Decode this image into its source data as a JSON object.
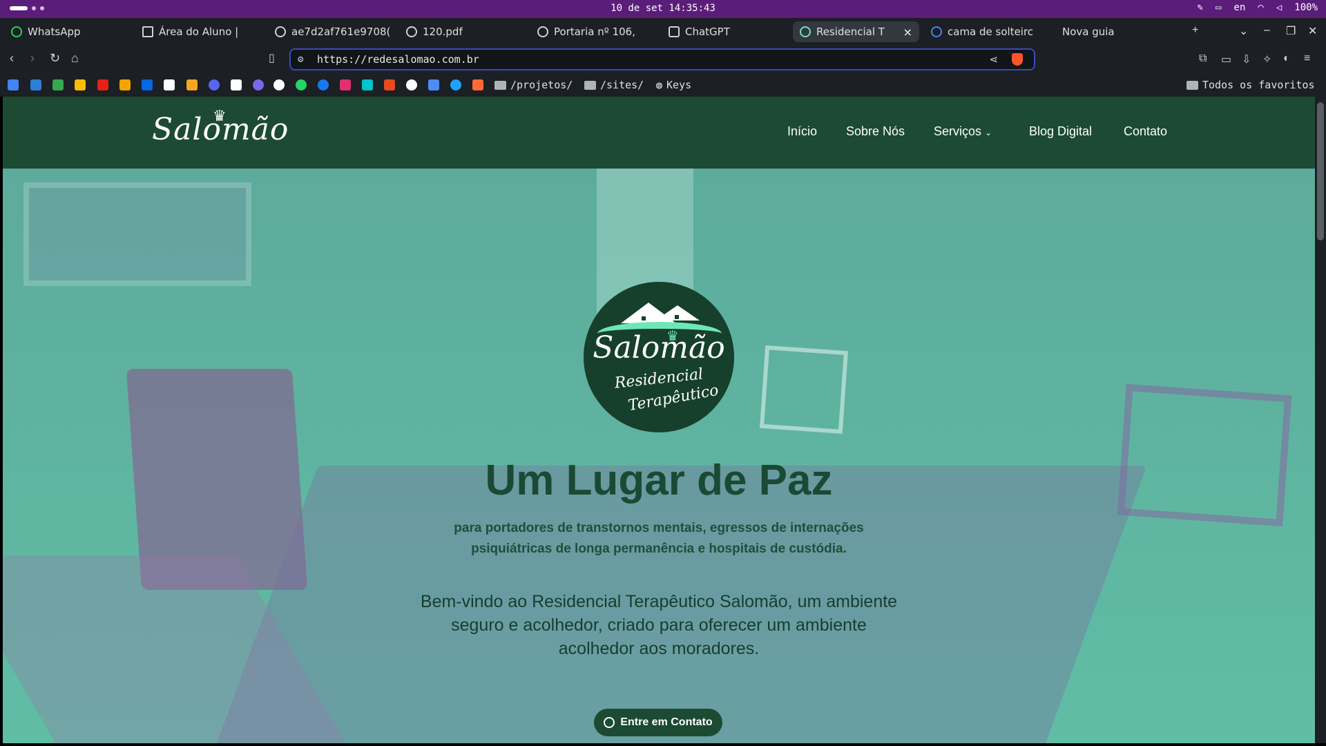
{
  "os_bar": {
    "clock": "10 de set 14:35:43",
    "lang": "en",
    "battery": "100%"
  },
  "tabs": [
    {
      "label": "WhatsApp"
    },
    {
      "label": "Área do Aluno |"
    },
    {
      "label": "ae7d2af761e9708("
    },
    {
      "label": "120.pdf"
    },
    {
      "label": "Portaria nº 106,"
    },
    {
      "label": "ChatGPT"
    },
    {
      "label": "Residencial T"
    },
    {
      "label": "cama de solteirc"
    },
    {
      "label": "Nova guia"
    }
  ],
  "address": {
    "url": "https://redesalomao.com.br"
  },
  "bookmarks": {
    "projetos": "/projetos/",
    "sites": "/sites/",
    "keys": "Keys",
    "all": "Todos os favoritos"
  },
  "site": {
    "logo": "Salomão",
    "nav": {
      "inicio": "Início",
      "sobre": "Sobre Nós",
      "servicos": "Serviços",
      "blog": "Blog Digital",
      "contato": "Contato"
    }
  },
  "hero": {
    "logo_name": "Salomão",
    "logo_sub1": "Residencial",
    "logo_sub2": "Terapêutico",
    "title": "Um Lugar de Paz",
    "subtitle": "para portadores de transtornos mentais, egressos de internações psiquiátricas de longa permanência e hospitais de custódia.",
    "welcome": "Bem-vindo ao Residencial Terapêutico Salomão, um ambiente seguro e acolhedor, criado para oferecer um ambiente acolhedor aos moradores.",
    "cta": "Entre em Contato"
  }
}
